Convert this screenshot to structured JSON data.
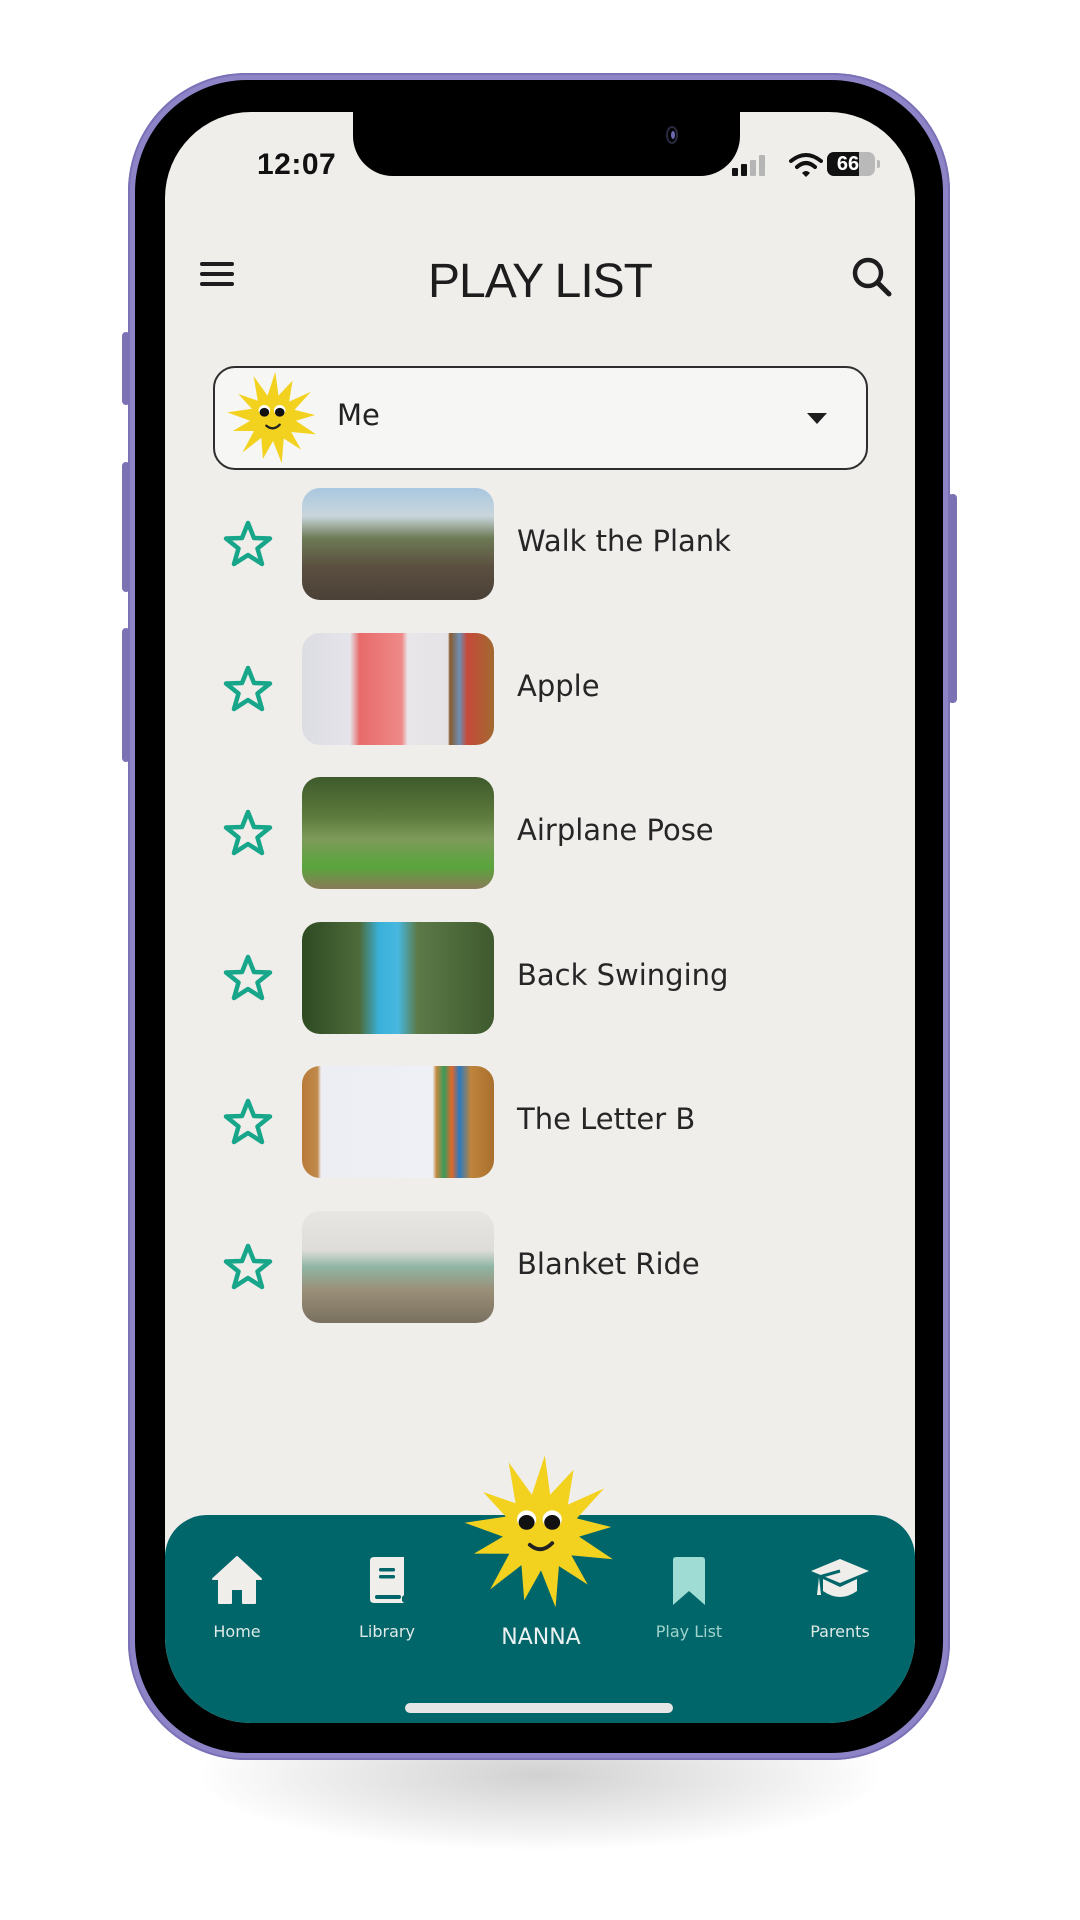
{
  "status_bar": {
    "time": "12:07",
    "battery": "66",
    "battery_level_percent": 66
  },
  "header": {
    "title": "PLAY LIST",
    "menu_icon": "hamburger-icon",
    "search_icon": "search-icon"
  },
  "profile_select": {
    "selected": "Me",
    "avatar_icon": "sun-mascot-icon",
    "caret_icon": "caret-down-icon"
  },
  "playlist": [
    {
      "title": "Walk the Plank",
      "favorite": false,
      "thumbnail": "kids-walking-outdoors"
    },
    {
      "title": "Apple",
      "favorite": false,
      "thumbnail": "drawing-red-apple"
    },
    {
      "title": "Airplane Pose",
      "favorite": false,
      "thumbnail": "woman-airplane-yoga-pose"
    },
    {
      "title": "Back Swinging",
      "favorite": false,
      "thumbnail": "blue-hammock-swing"
    },
    {
      "title": "The Letter B",
      "favorite": false,
      "thumbnail": "letter-b-notepad-crayons"
    },
    {
      "title": "Blanket Ride",
      "favorite": false,
      "thumbnail": "child-pulling-blanket"
    }
  ],
  "bottom_nav": {
    "items": [
      {
        "label": "Home",
        "icon": "home-icon",
        "active": false
      },
      {
        "label": "Library",
        "icon": "book-icon",
        "active": false
      },
      {
        "label": "NANNA",
        "icon": "sun-mascot-icon",
        "active": false
      },
      {
        "label": "Play List",
        "icon": "bookmark-icon",
        "active": true
      },
      {
        "label": "Parents",
        "icon": "graduation-cap-icon",
        "active": false
      }
    ]
  },
  "colors": {
    "background": "#efeeeb",
    "nav_bar": "#006669",
    "accent_star": "#17a68a",
    "active_icon": "#9fdcd4",
    "sun": "#f3d21f",
    "phone_frame": "#8d84c8"
  }
}
